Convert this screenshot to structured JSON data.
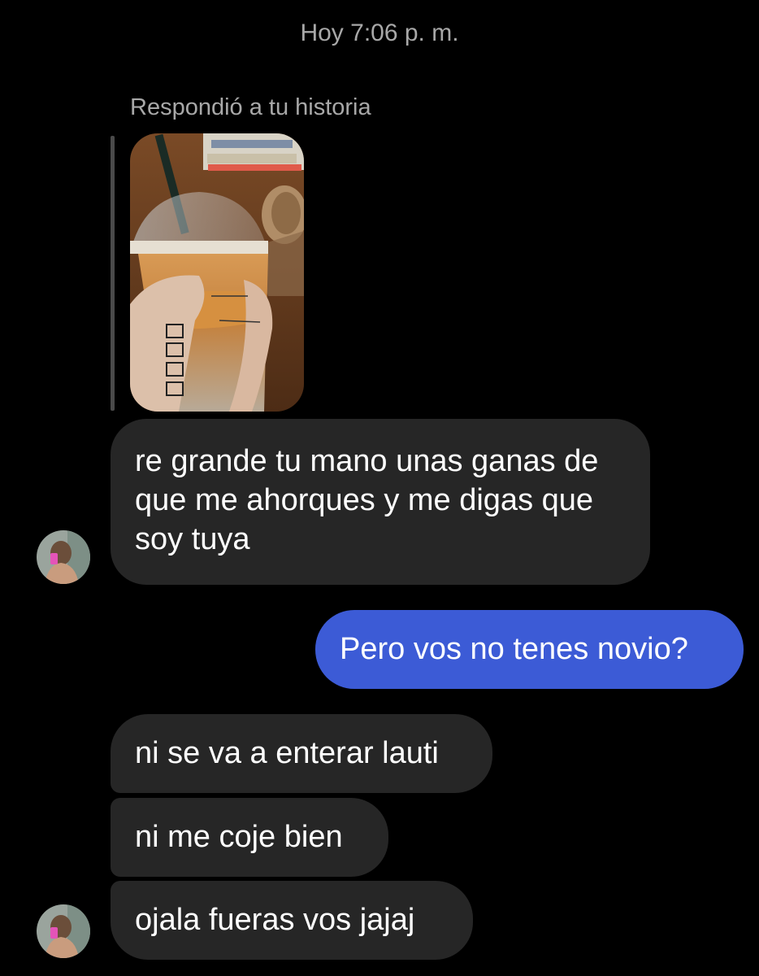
{
  "conversation": {
    "timestamp": "Hoy 7:06 p. m.",
    "reply_label": "Respondió a tu historia",
    "messages": [
      {
        "sender": "them",
        "text": "re grande tu mano unas ganas de que me ahorques y me digas que soy tuya"
      },
      {
        "sender": "me",
        "text": "Pero vos no tenes novio?"
      },
      {
        "sender": "them",
        "text": "ni se va a enterar lauti"
      },
      {
        "sender": "them",
        "text": "ni me coje bien"
      },
      {
        "sender": "them",
        "text": "ojala fueras vos jajaj"
      }
    ]
  },
  "colors": {
    "background": "#000000",
    "incoming_bubble": "#262626",
    "outgoing_bubble": "#3c5bd6",
    "meta_text": "#a8a8a8"
  }
}
